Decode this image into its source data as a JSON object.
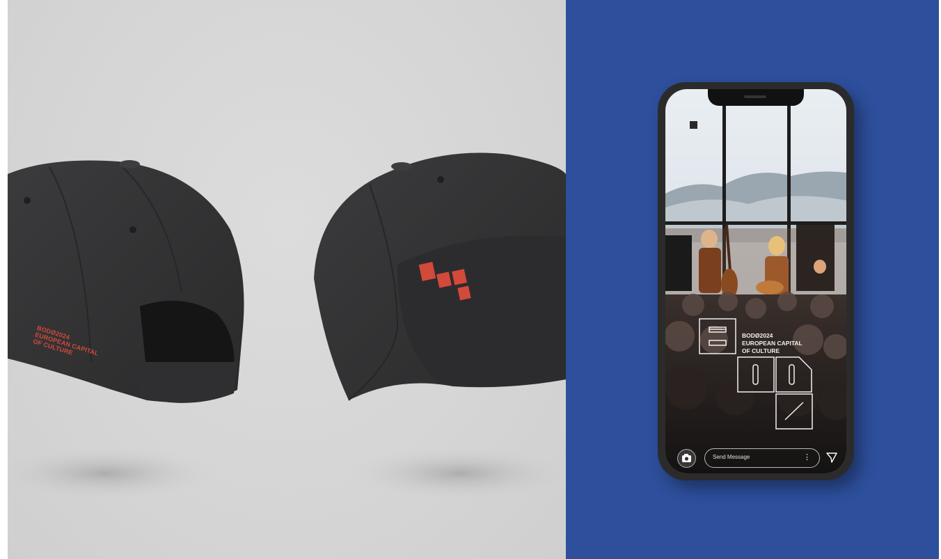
{
  "cap_back": {
    "lines": [
      "BODØ2024",
      "EUROPEAN CAPITAL",
      "OF CULTURE"
    ]
  },
  "phone_story": {
    "title_lines": [
      "BODØ2024",
      "EUROPEAN CAPITAL",
      "OF CULTURE"
    ],
    "message_placeholder": "Send Message",
    "more_glyph": "⋮"
  },
  "colors": {
    "left_background": "#d6d6d6",
    "right_background": "#2d4f9c",
    "cap_color": "#343436",
    "logo_red": "#d3493a"
  },
  "icons": [
    "camera-icon",
    "send-icon",
    "more-icon"
  ]
}
